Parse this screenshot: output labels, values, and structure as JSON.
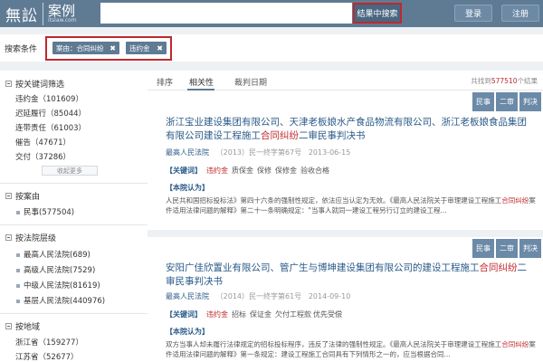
{
  "header": {
    "logo_mark": "無訟",
    "logo_cn": "案例",
    "logo_sub": "itslaw.com",
    "search_value": "",
    "search_button": "结果中搜索",
    "login": "登录",
    "register": "注册"
  },
  "conditions": {
    "label": "搜索条件",
    "tags": [
      {
        "text": "案由：合同纠纷",
        "close": "✖"
      },
      {
        "text": "违约金",
        "close": "✖"
      }
    ]
  },
  "sidebar": {
    "keyword_section": {
      "title": "按关键词筛选",
      "items": [
        "违约金（101609）",
        "迟延履行（85044）",
        "连带责任（61003）",
        "催告（47671）",
        "交付（37286）"
      ],
      "collapse": "收起更多"
    },
    "cause_section": {
      "title": "按案由",
      "items": [
        "民事(577504)"
      ]
    },
    "court_section": {
      "title": "按法院层级",
      "items": [
        "最高人民法院(689)",
        "高级人民法院(7529)",
        "中级人民法院(81619)",
        "基层人民法院(440976)"
      ]
    },
    "region_section": {
      "title": "按地域",
      "items": [
        "浙江省（159277）",
        "江苏省（52677）"
      ]
    }
  },
  "main": {
    "sort": {
      "label": "排序",
      "options": [
        "相关性",
        "裁判日期"
      ]
    },
    "total": {
      "prefix": "共找到",
      "count": "577510",
      "suffix": "个结果"
    },
    "cases": [
      {
        "badges": [
          "民事",
          "二审",
          "判决"
        ],
        "title_before": "浙江宝业建设集团有限公司、天津老板娘水产食品物流有限公司、浙江老板娘食品集团有限公司建设工程施工",
        "title_hl": "合同纠纷",
        "title_after": "二审民事判决书",
        "court": "最高人民法院",
        "case_no": "（2013）民一终字第67号",
        "date": "2013-06-15",
        "kw_label": "【关键词】",
        "keywords": [
          "违约金",
          "质保金",
          "保修",
          "保修金",
          "验收合格"
        ],
        "view_label": "【本院认为】",
        "text_l1": "人民共和国招标投标法》第四十六条的强制性规定，依法应当认定为无效。《最高人民法院关于审理建设工程施工",
        "text_l2_hl": "合同纠纷",
        "text_l2": "案件适用法律问题的解释》第二十一条明确规定：\"当事人就同一建设工程另行订立的建设工程..."
      },
      {
        "badges": [
          "民事",
          "二审",
          "判决"
        ],
        "title_before": "安阳广佳欣置业有限公司、管广生与博坤建设集团有限公司的建设工程施工",
        "title_hl": "合同纠纷",
        "title_after": "二审民事判决书",
        "court": "最高人民法院",
        "case_no": "（2014）民一终字第61号",
        "date": "2014-09-10",
        "kw_label": "【关键词】",
        "keywords": [
          "违约金",
          "招标",
          "保证金",
          "欠付工程款",
          "优先受偿"
        ],
        "view_label": "【本院认为】",
        "text_l1": "双方当事人却未履行法律规定的招标投标程序，违反了法律的强制性规定。《最高人民法院关于审理建设工程施工",
        "text_l2_hl": "合同纠纷",
        "text_l2": "案件适用法律问题的解释》第一条规定：建设工程施工合同具有下列情形之一的，应当根据合同..."
      }
    ]
  },
  "colors": {
    "header_bg": "#5f7a93",
    "highlight": "#c0282d",
    "link": "#2a5a88",
    "badge": "#6b8aa8"
  }
}
